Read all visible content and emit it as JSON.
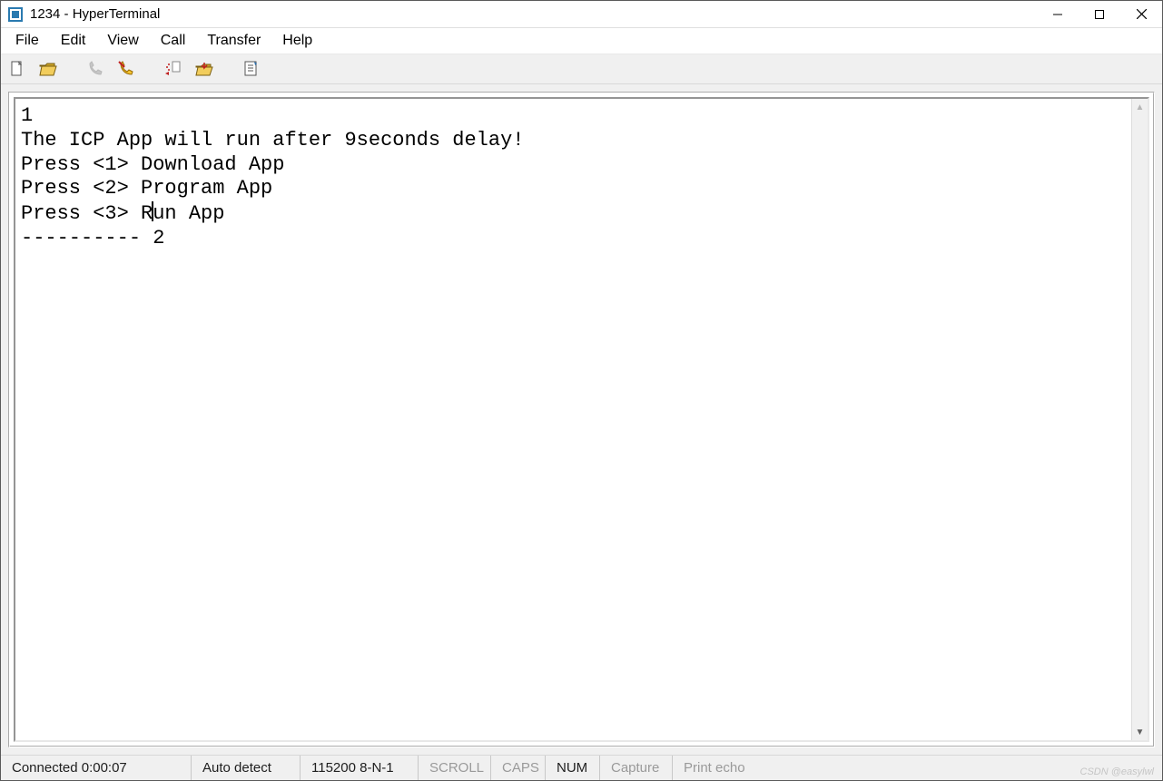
{
  "window": {
    "title": "1234 - HyperTerminal"
  },
  "menu": {
    "file": "File",
    "edit": "Edit",
    "view": "View",
    "call": "Call",
    "transfer": "Transfer",
    "help": "Help"
  },
  "toolbar": {
    "icons": {
      "new": "new-icon",
      "open": "open-icon",
      "call": "call-icon",
      "disconnect": "disconnect-icon",
      "send": "send-icon",
      "receive": "receive-icon",
      "properties": "properties-icon"
    }
  },
  "terminal": {
    "lines": [
      "1",
      "The ICP App will run after 9seconds delay!",
      "Press <1> Download App",
      "Press <2> Program App",
      "Press <3> Run App",
      "---------- 2"
    ]
  },
  "status": {
    "connected": "Connected 0:00:07",
    "autodetect": "Auto detect",
    "port": "115200 8-N-1",
    "scroll": "SCROLL",
    "caps": "CAPS",
    "num": "NUM",
    "capture": "Capture",
    "printecho": "Print echo"
  },
  "watermark": "CSDN @easylwl"
}
